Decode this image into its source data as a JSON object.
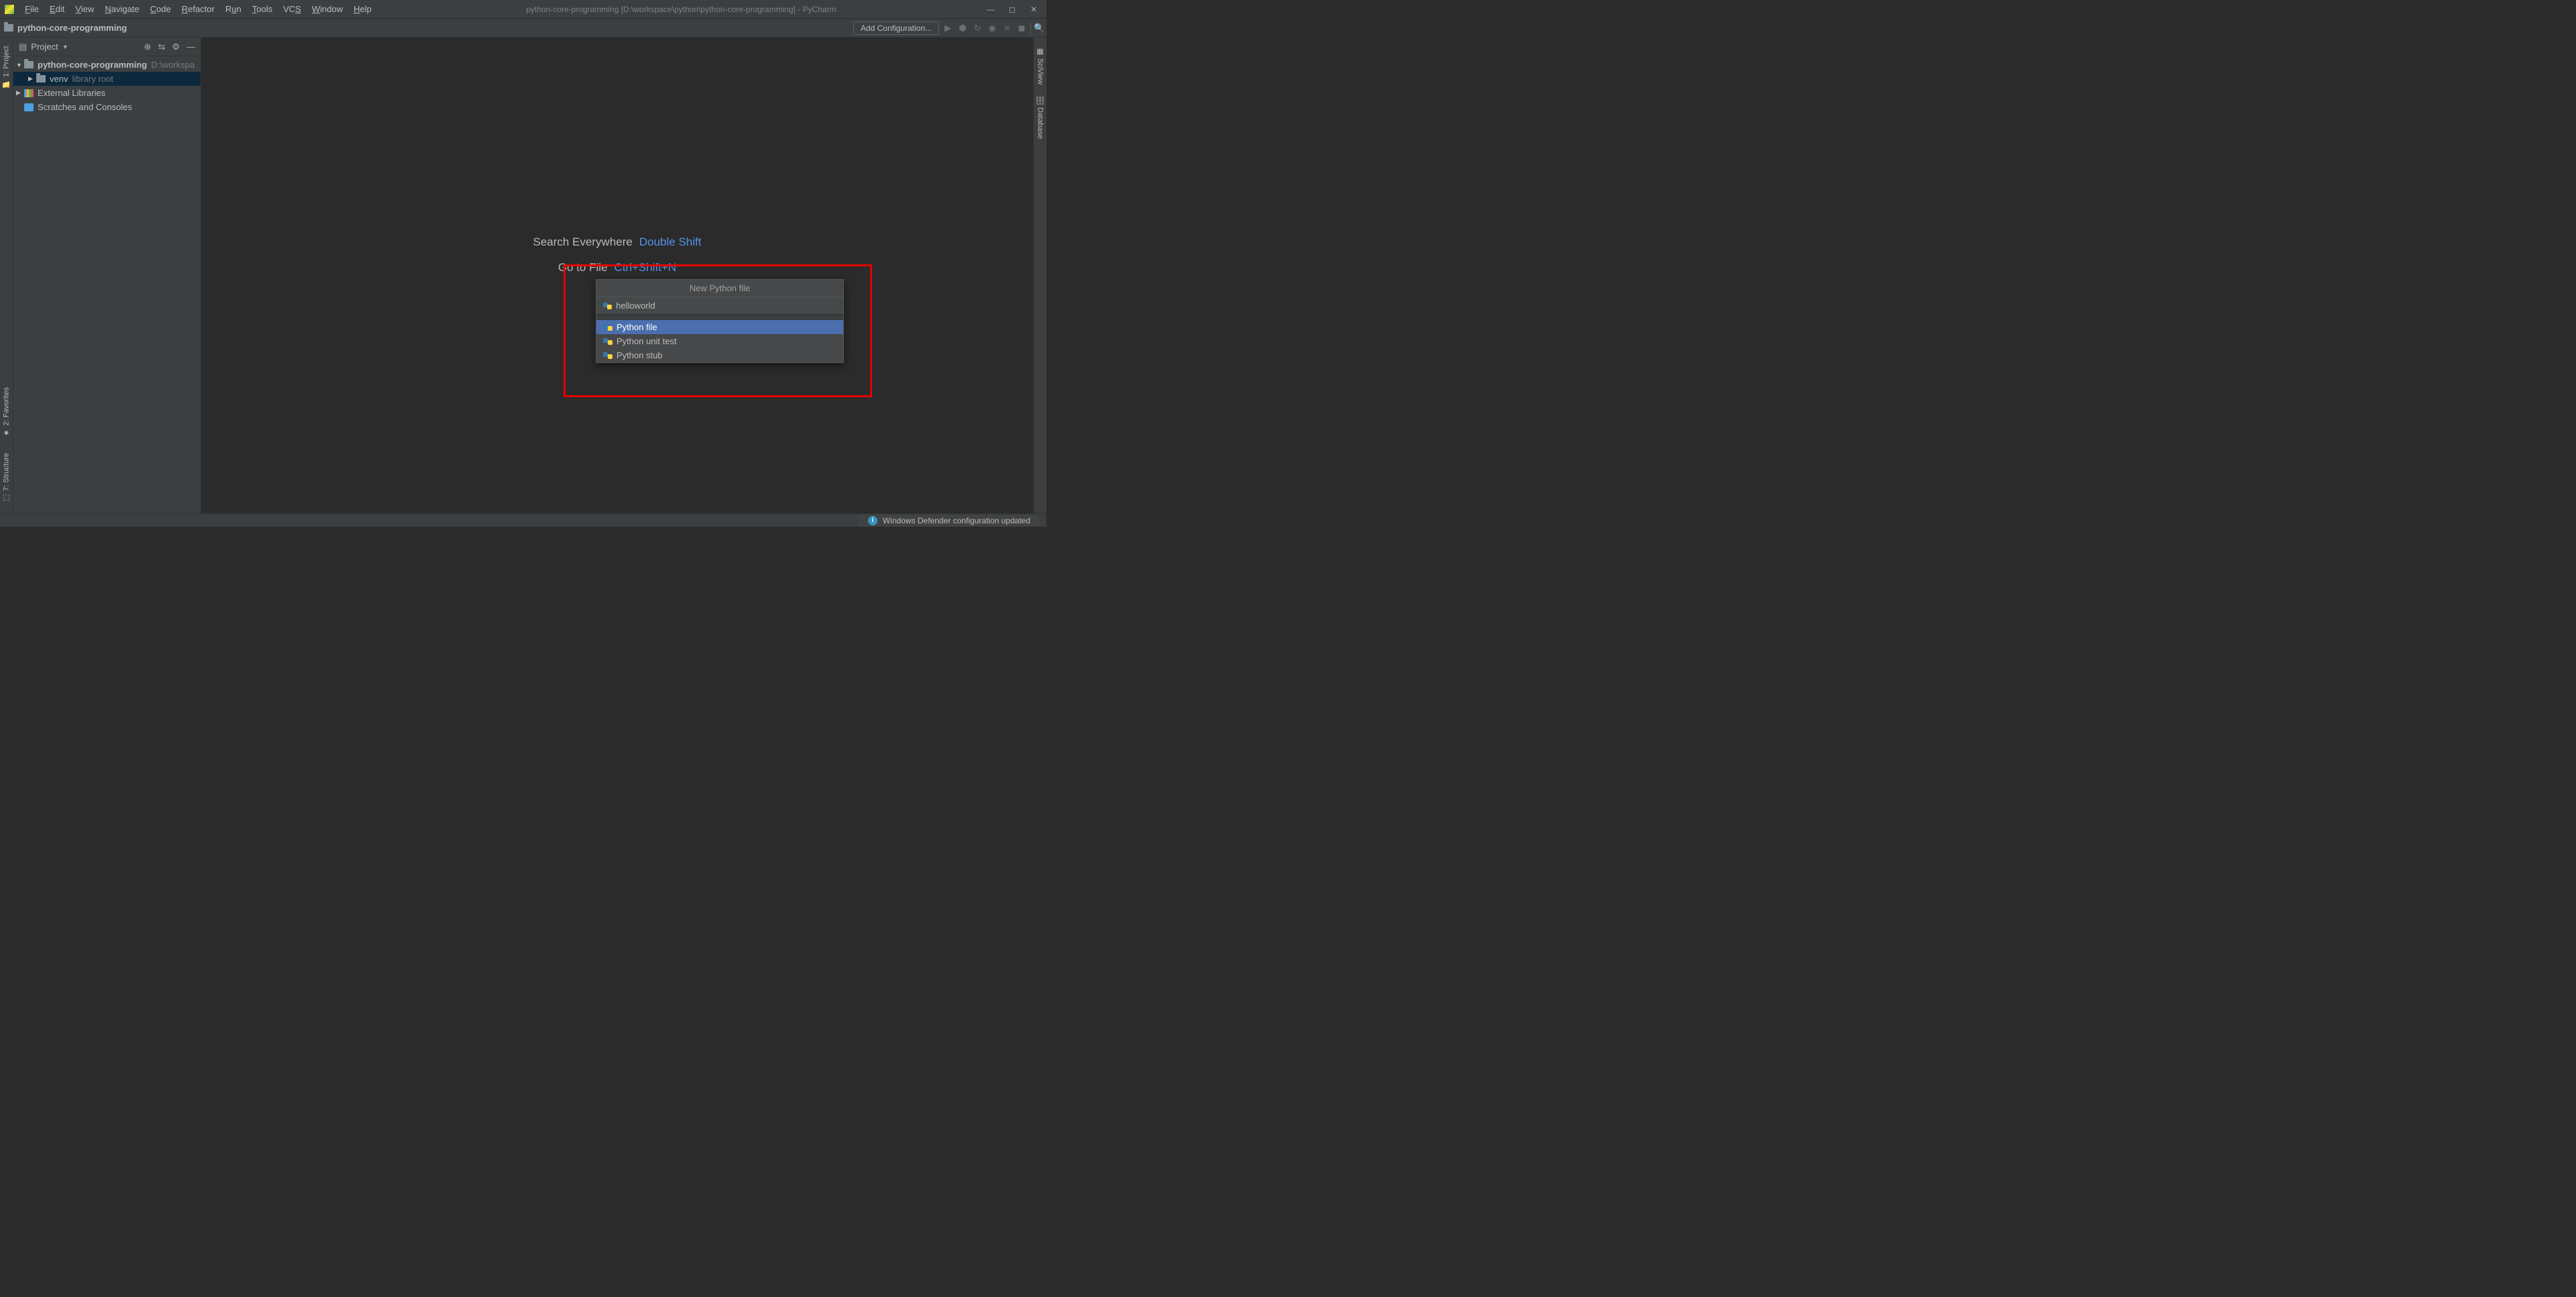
{
  "menu": {
    "file": "File",
    "edit": "Edit",
    "view": "View",
    "navigate": "Navigate",
    "code": "Code",
    "refactor": "Refactor",
    "run": "Run",
    "tools": "Tools",
    "vcs": "VCS",
    "window": "Window",
    "help": "Help"
  },
  "title": "python-core-programming [D:\\workspace\\python\\python-core-programming] - PyCharm",
  "breadcrumb": "python-core-programming",
  "add_config": "Add Configuration...",
  "left_tabs": {
    "project": "1: Project",
    "structure": "7: Structure",
    "favorites": "2: Favorites"
  },
  "right_tabs": {
    "sciview": "SciView",
    "database": "Database"
  },
  "panel": {
    "title": "Project"
  },
  "tree": {
    "root_name": "python-core-programming",
    "root_path": "D:\\workspa",
    "venv": "venv",
    "venv_hint": "library root",
    "ext_lib": "External Libraries",
    "scratches": "Scratches and Consoles"
  },
  "welcome": {
    "search": "Search Everywhere",
    "search_key": "Double Shift",
    "goto": "Go to File",
    "goto_key": "Ctrl+Shift+N"
  },
  "popup": {
    "title": "New Python file",
    "input_value": "helloworld",
    "items": [
      "Python file",
      "Python unit test",
      "Python stub"
    ]
  },
  "status": {
    "notif": "Windows Defender configuration updated"
  }
}
